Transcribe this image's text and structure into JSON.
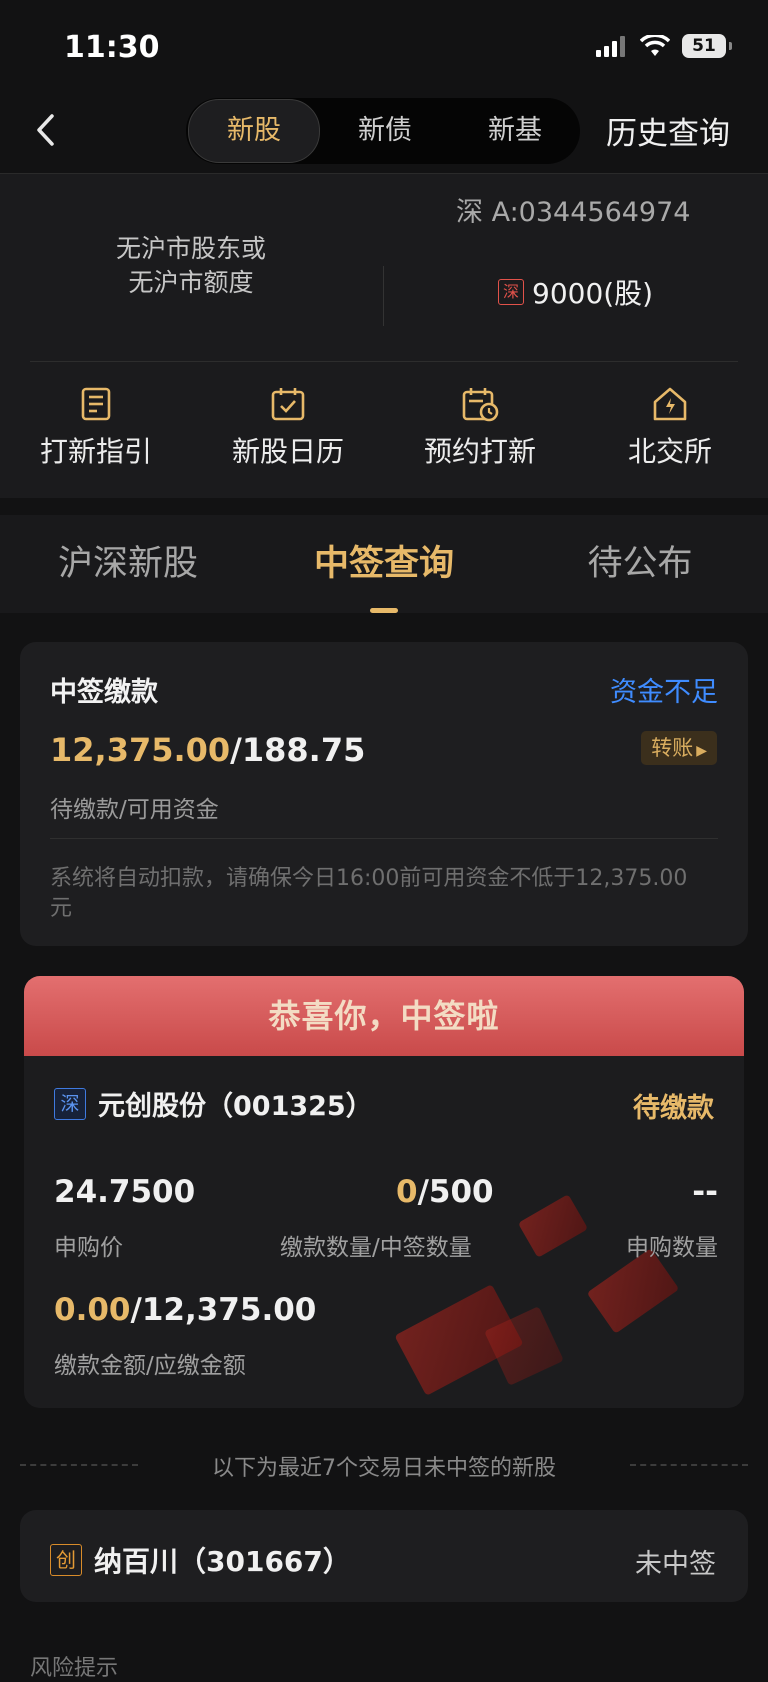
{
  "status_bar": {
    "time": "11:30",
    "battery": "51"
  },
  "nav": {
    "segments": [
      "新股",
      "新债",
      "新基"
    ],
    "history": "历史查询"
  },
  "account": {
    "sh_notice_line1": "无沪市股东或",
    "sh_notice_line2": "无沪市额度",
    "sz_account": "深 A:0344564974",
    "sz_tag": "深",
    "sz_quota": "9000(股)"
  },
  "quick_actions": [
    {
      "label": "打新指引",
      "icon": "guide-icon"
    },
    {
      "label": "新股日历",
      "icon": "calendar-check-icon"
    },
    {
      "label": "预约打新",
      "icon": "calendar-clock-icon"
    },
    {
      "label": "北交所",
      "icon": "exchange-house-icon"
    }
  ],
  "tabs": [
    "沪深新股",
    "中签查询",
    "待公布"
  ],
  "payment": {
    "title": "中签缴款",
    "insufficient": "资金不足",
    "pending_amount": "12,375.00",
    "available": "/188.75",
    "transfer": "转账",
    "sub_label": "待缴款/可用资金",
    "note": "系统将自动扣款，请确保今日16:00前可用资金不低于12,375.00元"
  },
  "winning": {
    "banner": "恭喜你，中签啦",
    "exchange_tag": "深",
    "stock_name": "元创股份（001325）",
    "status": "待缴款",
    "price": "24.7500",
    "price_label": "申购价",
    "paid_qty": "0",
    "won_qty": "/500",
    "qty_label": "缴款数量/中签数量",
    "apply_qty": "--",
    "apply_qty_label": "申购数量",
    "paid_amt": "0.00",
    "due_amt": "/12,375.00",
    "amt_label": "缴款金额/应缴金额"
  },
  "separator_text": "以下为最近7个交易日未中签的新股",
  "not_won": {
    "tag": "创",
    "name": "纳百川（301667）",
    "status": "未中签"
  },
  "footer": {
    "risk": "风险提示"
  },
  "colors": {
    "accent_gold": "#e7b969",
    "link_blue": "#3f8cff",
    "banner_red": "#d65a5a"
  }
}
